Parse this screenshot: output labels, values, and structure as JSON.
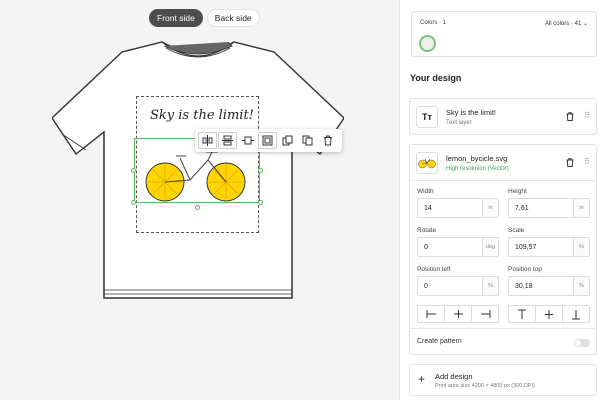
{
  "canvas": {
    "tabs": [
      {
        "label": "Front side",
        "active": true
      },
      {
        "label": "Back side",
        "active": false
      }
    ],
    "design_text": "Sky is the limit!",
    "toolbar_icons": [
      "align-vertical-center-icon",
      "align-horizontal-center-icon",
      "fit-width-icon",
      "fit-area-icon",
      "bring-forward-icon",
      "duplicate-icon",
      "delete-icon"
    ]
  },
  "colors": {
    "label": "Colors · 1",
    "all_colors": "All colors · 41",
    "selected_swatch": "#eeeeee",
    "accent": "#7bc47b"
  },
  "design": {
    "title": "Your design",
    "layers": [
      {
        "name": "Sky is the limit!",
        "sub": "Text layer",
        "icon": "Tт"
      },
      {
        "name": "lemon_bycicle.svg",
        "sub": "High resolution (Vector)"
      }
    ],
    "fields": {
      "width": {
        "label": "Width",
        "value": "14",
        "unit": "in"
      },
      "height": {
        "label": "Height",
        "value": "7,61",
        "unit": "in"
      },
      "rotate": {
        "label": "Rotate",
        "value": "0",
        "unit": "deg"
      },
      "scale": {
        "label": "Scale",
        "value": "109,57",
        "unit": "%"
      },
      "pos_left": {
        "label": "Position left",
        "value": "0",
        "unit": "%"
      },
      "pos_top": {
        "label": "Position top",
        "value": "30,18",
        "unit": "%"
      }
    },
    "create_pattern": "Create pattern",
    "add_design": {
      "title": "Add design",
      "sub": "Print area size 4200 × 4800 px (300 DPI)"
    }
  }
}
